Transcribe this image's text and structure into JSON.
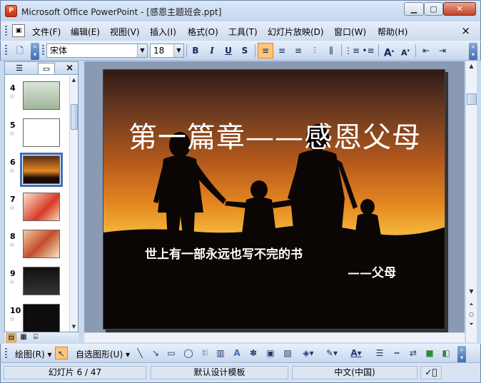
{
  "window": {
    "app_icon_glyph": "P",
    "title": "Microsoft Office PowerPoint - [感恩主题班会.ppt]",
    "minimize_glyph": "▁",
    "restore_glyph": "▢",
    "close_glyph": "✕"
  },
  "menu": {
    "items": [
      "文件(F)",
      "编辑(E)",
      "视图(V)",
      "插入(I)",
      "格式(O)",
      "工具(T)",
      "幻灯片放映(D)",
      "窗口(W)",
      "帮助(H)"
    ],
    "close_glyph": "×"
  },
  "toolbar": {
    "font_name": "宋体",
    "font_size": "18",
    "bold": "B",
    "italic": "I",
    "underline": "U",
    "shadow": "S",
    "grow_font": "A",
    "shrink_font": "A"
  },
  "panel": {
    "tab_outline_icon": "outline-icon",
    "tab_slides_icon": "slides-icon",
    "close_glyph": "×",
    "slides": [
      {
        "num": "4",
        "theme": "calc"
      },
      {
        "num": "5",
        "theme": "text"
      },
      {
        "num": "6",
        "theme": "sunset",
        "selected": true
      },
      {
        "num": "7",
        "theme": "red"
      },
      {
        "num": "8",
        "theme": "collage"
      },
      {
        "num": "9",
        "theme": "dark"
      },
      {
        "num": "10",
        "theme": "darktext"
      }
    ]
  },
  "slide": {
    "title": "第一篇章——感恩父母",
    "line1": "世上有一部永远也写不完的书",
    "line2": "——父母"
  },
  "drawbar": {
    "draw_label": "绘图(R)",
    "autoshapes_label": "自选图形(U)"
  },
  "status": {
    "slide_info": "幻灯片 6 / 47",
    "template": "默认设计模板",
    "language": "中文(中国)"
  },
  "colors": {
    "accent": "#3d6fb6",
    "toolbar_active": "#ffc57a"
  }
}
